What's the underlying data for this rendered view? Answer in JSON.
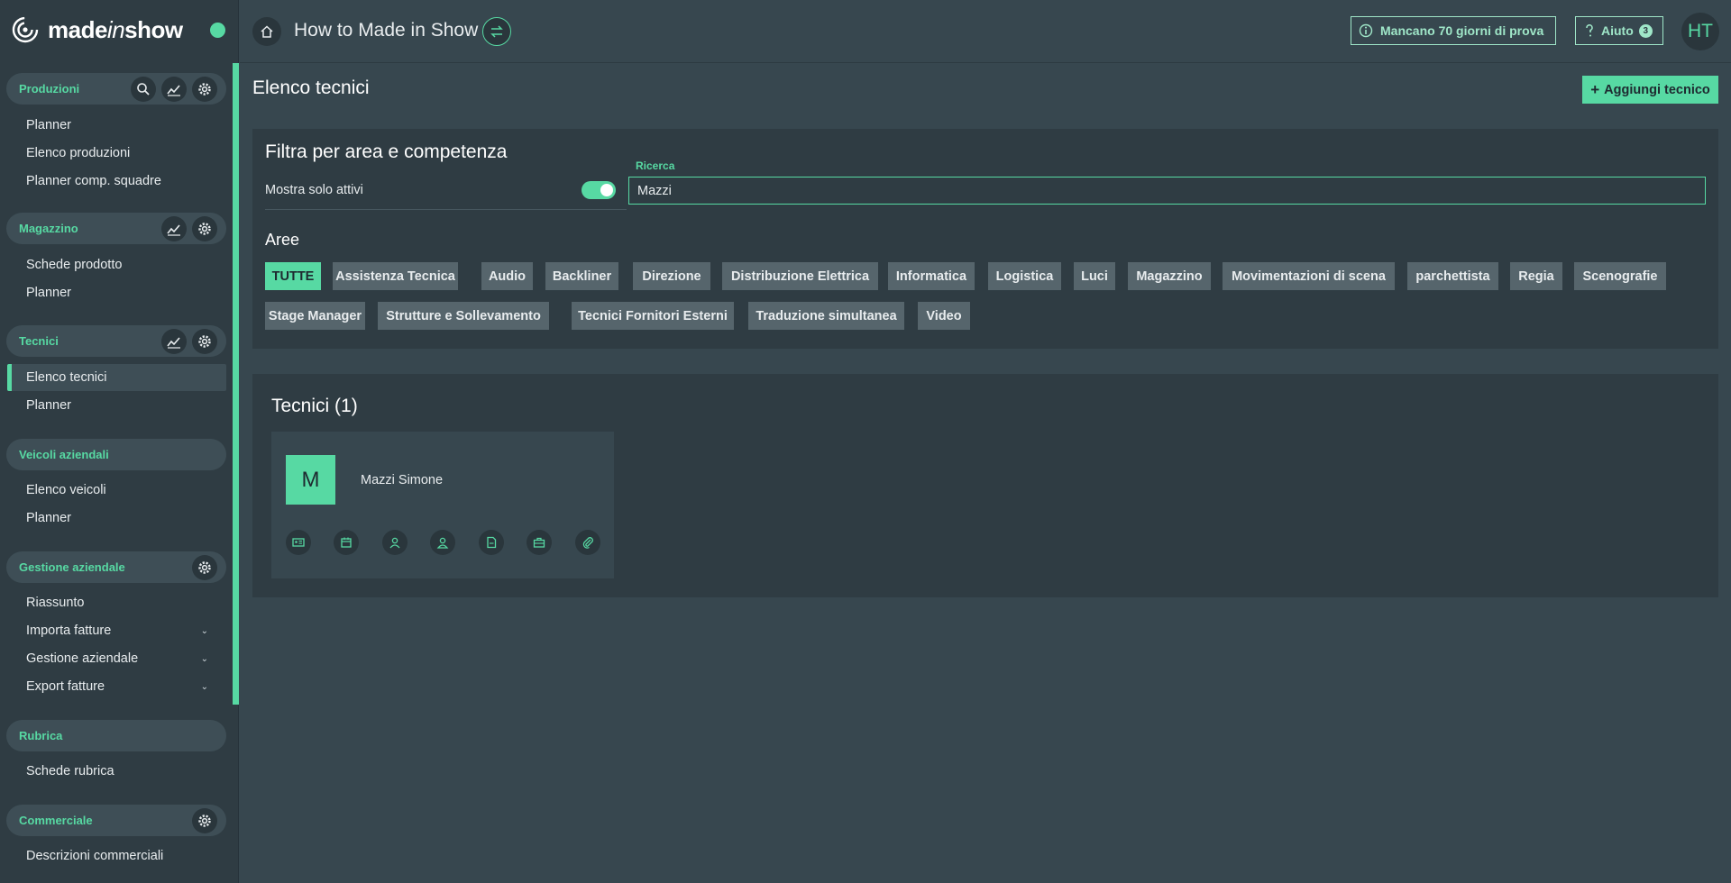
{
  "brand": {
    "name_prefix": "made",
    "name_italic": "in",
    "name_suffix": "show"
  },
  "colors": {
    "accent": "#57d9a3",
    "background": "#37474f",
    "panel": "#2f3c43"
  },
  "sidebar": {
    "sections": [
      {
        "title": "Produzioni",
        "icons": [
          "search-icon",
          "chart-icon",
          "gear-icon"
        ],
        "items": [
          {
            "label": "Planner"
          },
          {
            "label": "Elenco produzioni"
          },
          {
            "label": "Planner comp. squadre"
          }
        ]
      },
      {
        "title": "Magazzino",
        "icons": [
          "chart-icon",
          "gear-icon"
        ],
        "items": [
          {
            "label": "Schede prodotto"
          },
          {
            "label": "Planner"
          }
        ]
      },
      {
        "title": "Tecnici",
        "icons": [
          "chart-icon",
          "gear-icon"
        ],
        "items": [
          {
            "label": "Elenco tecnici",
            "active": true
          },
          {
            "label": "Planner"
          }
        ]
      },
      {
        "title": "Veicoli aziendali",
        "icons": [],
        "items": [
          {
            "label": "Elenco veicoli"
          },
          {
            "label": "Planner"
          }
        ]
      },
      {
        "title": "Gestione aziendale",
        "icons": [
          "gear-icon"
        ],
        "items": [
          {
            "label": "Riassunto"
          },
          {
            "label": "Importa fatture",
            "expandable": true
          },
          {
            "label": "Gestione aziendale",
            "expandable": true
          },
          {
            "label": "Export fatture",
            "expandable": true
          }
        ]
      },
      {
        "title": "Rubrica",
        "icons": [],
        "items": [
          {
            "label": "Schede rubrica"
          }
        ]
      },
      {
        "title": "Commerciale",
        "icons": [
          "gear-icon"
        ],
        "items": [
          {
            "label": "Descrizioni commerciali"
          }
        ]
      }
    ]
  },
  "header": {
    "title": "How to Made in Show",
    "trial_text": "Mancano 70 giorni di prova",
    "help_label": "Aiuto",
    "help_count": "3",
    "avatar_initials": "HT"
  },
  "main": {
    "page_title": "Elenco tecnici",
    "add_button_label": "Aggiungi tecnico",
    "filter": {
      "title": "Filtra per area e competenza",
      "active_only_label": "Mostra solo attivi",
      "active_only": true,
      "search_label": "Ricerca",
      "search_value": "Mazzi"
    },
    "areas": {
      "title": "Aree",
      "chips": [
        {
          "label": "TUTTE",
          "selected": true
        },
        {
          "label": "Assistenza Tecnica"
        },
        {
          "label": "Audio"
        },
        {
          "label": "Backliner"
        },
        {
          "label": "Direzione"
        },
        {
          "label": "Distribuzione Elettrica"
        },
        {
          "label": "Informatica"
        },
        {
          "label": "Logistica"
        },
        {
          "label": "Luci"
        },
        {
          "label": "Magazzino"
        },
        {
          "label": "Movimentazioni di scena"
        },
        {
          "label": "parchettista"
        },
        {
          "label": "Regia"
        },
        {
          "label": "Scenografie"
        },
        {
          "label": "Stage Manager"
        },
        {
          "label": "Strutture e Sollevamento"
        },
        {
          "label": "Tecnici Fornitori Esterni"
        },
        {
          "label": "Traduzione simultanea"
        },
        {
          "label": "Video"
        }
      ]
    },
    "technicians": {
      "title": "Tecnici (1)",
      "items": [
        {
          "initial": "M",
          "name": "Mazzi Simone",
          "actions": [
            "id-card-icon",
            "calendar-icon",
            "user-icon",
            "user-badge-icon",
            "document-icon",
            "toolbox-icon",
            "attachment-icon"
          ]
        }
      ]
    }
  }
}
